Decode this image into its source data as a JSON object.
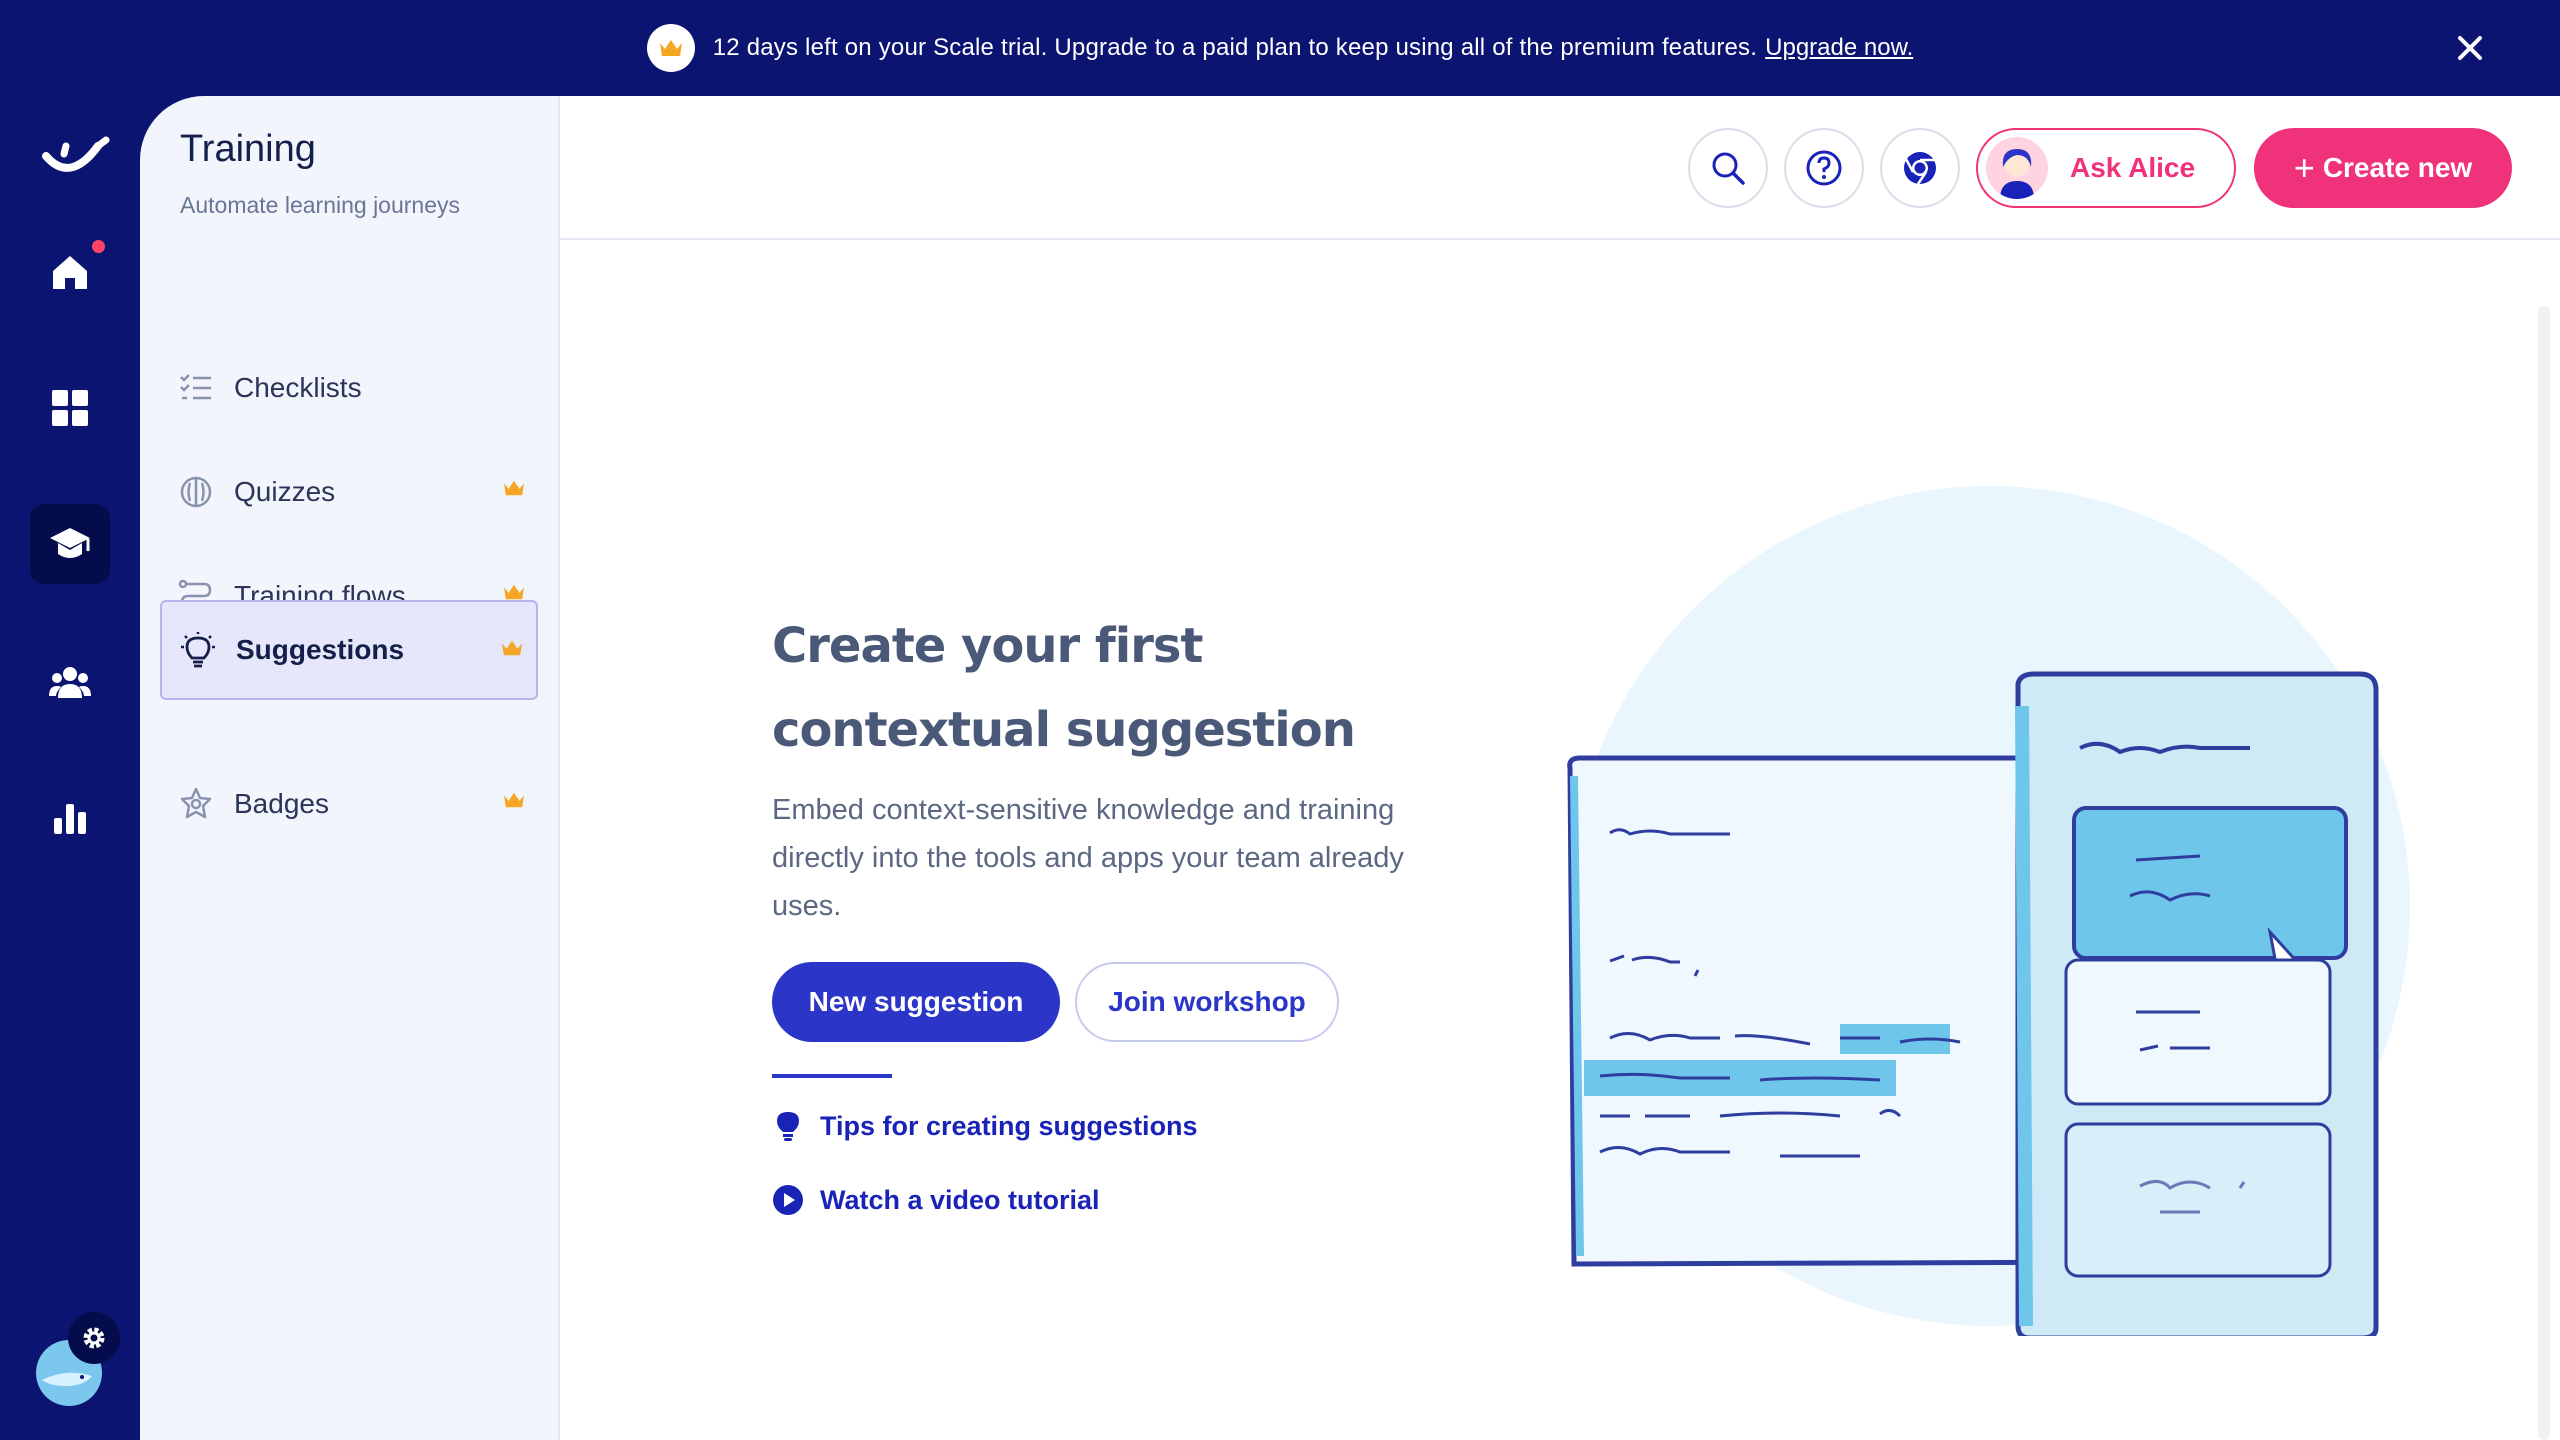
{
  "banner": {
    "message": "12 days left on your Scale trial. Upgrade to a paid plan to keep using all of the premium features.",
    "link": "Upgrade now."
  },
  "rail": {
    "items": [
      "home-icon",
      "dashboard-icon",
      "training-icon",
      "team-icon",
      "analytics-icon"
    ],
    "active": "training-icon"
  },
  "panel": {
    "title": "Training",
    "subtitle": "Automate learning journeys",
    "items": [
      {
        "label": "Checklists",
        "icon": "checklist-icon",
        "premium": false
      },
      {
        "label": "Quizzes",
        "icon": "brain-icon",
        "premium": true
      },
      {
        "label": "Training flows",
        "icon": "flow-icon",
        "premium": true
      },
      {
        "label": "Suggestions",
        "icon": "lightbulb-icon",
        "premium": true,
        "active": true
      },
      {
        "label": "Badges",
        "icon": "badge-icon",
        "premium": true
      }
    ]
  },
  "header": {
    "ask_label": "Ask Alice",
    "create_label": "Create new"
  },
  "hero": {
    "title": "Create your first contextual suggestion",
    "description": "Embed context-sensitive knowledge and training directly into the tools and apps your team already uses.",
    "primary_button": "New suggestion",
    "secondary_button": "Join workshop",
    "links": [
      "Tips for creating suggestions",
      "Watch a video tutorial"
    ]
  },
  "colors": {
    "navy": "#0b1470",
    "pink": "#f0327a",
    "primary": "#2b36c9",
    "crown": "#f5a623"
  }
}
